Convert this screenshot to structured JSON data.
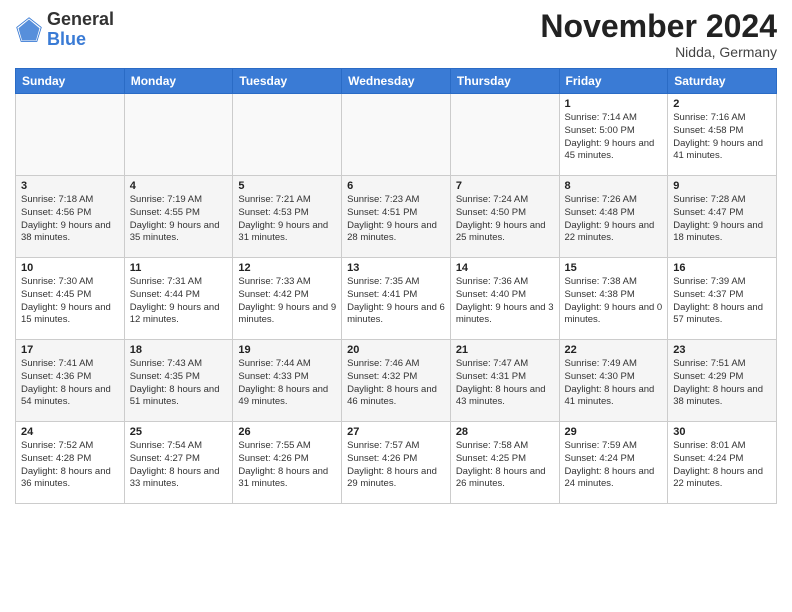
{
  "header": {
    "logo_general": "General",
    "logo_blue": "Blue",
    "month_title": "November 2024",
    "location": "Nidda, Germany"
  },
  "weekdays": [
    "Sunday",
    "Monday",
    "Tuesday",
    "Wednesday",
    "Thursday",
    "Friday",
    "Saturday"
  ],
  "weeks": [
    [
      {
        "day": "",
        "info": ""
      },
      {
        "day": "",
        "info": ""
      },
      {
        "day": "",
        "info": ""
      },
      {
        "day": "",
        "info": ""
      },
      {
        "day": "",
        "info": ""
      },
      {
        "day": "1",
        "info": "Sunrise: 7:14 AM\nSunset: 5:00 PM\nDaylight: 9 hours\nand 45 minutes."
      },
      {
        "day": "2",
        "info": "Sunrise: 7:16 AM\nSunset: 4:58 PM\nDaylight: 9 hours\nand 41 minutes."
      }
    ],
    [
      {
        "day": "3",
        "info": "Sunrise: 7:18 AM\nSunset: 4:56 PM\nDaylight: 9 hours\nand 38 minutes."
      },
      {
        "day": "4",
        "info": "Sunrise: 7:19 AM\nSunset: 4:55 PM\nDaylight: 9 hours\nand 35 minutes."
      },
      {
        "day": "5",
        "info": "Sunrise: 7:21 AM\nSunset: 4:53 PM\nDaylight: 9 hours\nand 31 minutes."
      },
      {
        "day": "6",
        "info": "Sunrise: 7:23 AM\nSunset: 4:51 PM\nDaylight: 9 hours\nand 28 minutes."
      },
      {
        "day": "7",
        "info": "Sunrise: 7:24 AM\nSunset: 4:50 PM\nDaylight: 9 hours\nand 25 minutes."
      },
      {
        "day": "8",
        "info": "Sunrise: 7:26 AM\nSunset: 4:48 PM\nDaylight: 9 hours\nand 22 minutes."
      },
      {
        "day": "9",
        "info": "Sunrise: 7:28 AM\nSunset: 4:47 PM\nDaylight: 9 hours\nand 18 minutes."
      }
    ],
    [
      {
        "day": "10",
        "info": "Sunrise: 7:30 AM\nSunset: 4:45 PM\nDaylight: 9 hours\nand 15 minutes."
      },
      {
        "day": "11",
        "info": "Sunrise: 7:31 AM\nSunset: 4:44 PM\nDaylight: 9 hours\nand 12 minutes."
      },
      {
        "day": "12",
        "info": "Sunrise: 7:33 AM\nSunset: 4:42 PM\nDaylight: 9 hours\nand 9 minutes."
      },
      {
        "day": "13",
        "info": "Sunrise: 7:35 AM\nSunset: 4:41 PM\nDaylight: 9 hours\nand 6 minutes."
      },
      {
        "day": "14",
        "info": "Sunrise: 7:36 AM\nSunset: 4:40 PM\nDaylight: 9 hours\nand 3 minutes."
      },
      {
        "day": "15",
        "info": "Sunrise: 7:38 AM\nSunset: 4:38 PM\nDaylight: 9 hours\nand 0 minutes."
      },
      {
        "day": "16",
        "info": "Sunrise: 7:39 AM\nSunset: 4:37 PM\nDaylight: 8 hours\nand 57 minutes."
      }
    ],
    [
      {
        "day": "17",
        "info": "Sunrise: 7:41 AM\nSunset: 4:36 PM\nDaylight: 8 hours\nand 54 minutes."
      },
      {
        "day": "18",
        "info": "Sunrise: 7:43 AM\nSunset: 4:35 PM\nDaylight: 8 hours\nand 51 minutes."
      },
      {
        "day": "19",
        "info": "Sunrise: 7:44 AM\nSunset: 4:33 PM\nDaylight: 8 hours\nand 49 minutes."
      },
      {
        "day": "20",
        "info": "Sunrise: 7:46 AM\nSunset: 4:32 PM\nDaylight: 8 hours\nand 46 minutes."
      },
      {
        "day": "21",
        "info": "Sunrise: 7:47 AM\nSunset: 4:31 PM\nDaylight: 8 hours\nand 43 minutes."
      },
      {
        "day": "22",
        "info": "Sunrise: 7:49 AM\nSunset: 4:30 PM\nDaylight: 8 hours\nand 41 minutes."
      },
      {
        "day": "23",
        "info": "Sunrise: 7:51 AM\nSunset: 4:29 PM\nDaylight: 8 hours\nand 38 minutes."
      }
    ],
    [
      {
        "day": "24",
        "info": "Sunrise: 7:52 AM\nSunset: 4:28 PM\nDaylight: 8 hours\nand 36 minutes."
      },
      {
        "day": "25",
        "info": "Sunrise: 7:54 AM\nSunset: 4:27 PM\nDaylight: 8 hours\nand 33 minutes."
      },
      {
        "day": "26",
        "info": "Sunrise: 7:55 AM\nSunset: 4:26 PM\nDaylight: 8 hours\nand 31 minutes."
      },
      {
        "day": "27",
        "info": "Sunrise: 7:57 AM\nSunset: 4:26 PM\nDaylight: 8 hours\nand 29 minutes."
      },
      {
        "day": "28",
        "info": "Sunrise: 7:58 AM\nSunset: 4:25 PM\nDaylight: 8 hours\nand 26 minutes."
      },
      {
        "day": "29",
        "info": "Sunrise: 7:59 AM\nSunset: 4:24 PM\nDaylight: 8 hours\nand 24 minutes."
      },
      {
        "day": "30",
        "info": "Sunrise: 8:01 AM\nSunset: 4:24 PM\nDaylight: 8 hours\nand 22 minutes."
      }
    ]
  ]
}
